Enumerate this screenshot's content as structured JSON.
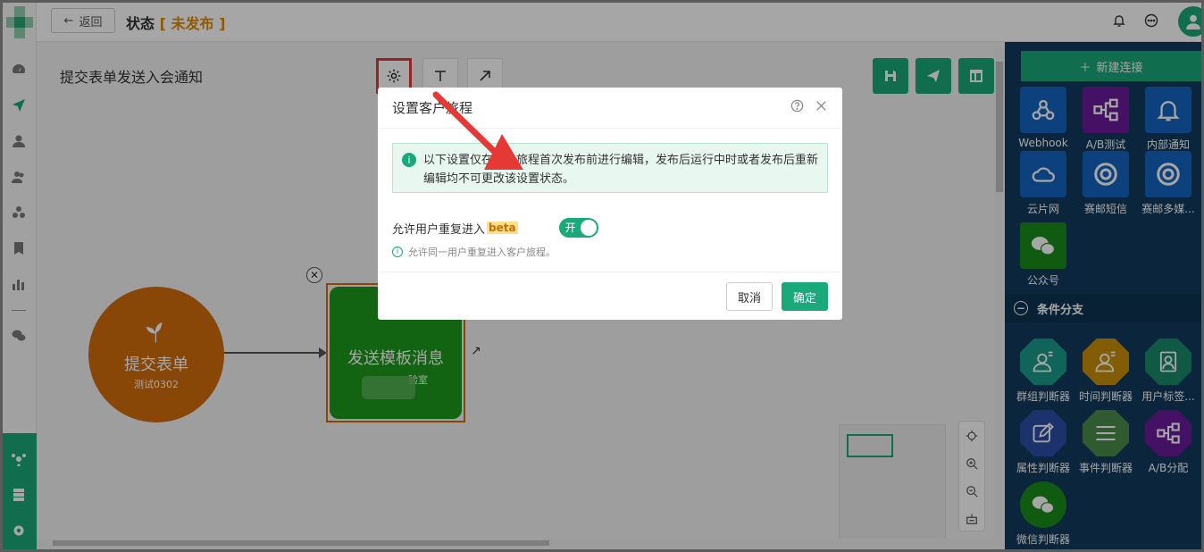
{
  "header": {
    "back_label": "返回",
    "title_prefix": "状态",
    "status_text": "未发布",
    "bracket_open": "[",
    "bracket_close": "]"
  },
  "journey": {
    "name": "提交表单发送入会通知",
    "toolbar": [
      "gear-icon",
      "text-icon",
      "arrow-icon"
    ]
  },
  "nodes": {
    "trigger_title": "提交表单",
    "trigger_sub": "测试0302",
    "action_title": "发送模板消息",
    "action_sub": "验室",
    "close_glyph": "✕"
  },
  "right_panel": {
    "new_connection_label": "新建连接",
    "channels": [
      {
        "label": "Webhook",
        "icon": "webhook-icon",
        "color": "#1565c0"
      },
      {
        "label": "A/B测试",
        "icon": "ab-test-icon",
        "color": "#6a1b9a"
      },
      {
        "label": "内部通知",
        "icon": "bell-icon",
        "color": "#1565c0"
      },
      {
        "label": "云片网",
        "icon": "cloud-icon",
        "color": "#1565c0"
      },
      {
        "label": "赛邮短信",
        "icon": "submail-icon",
        "color": "#1565c0"
      },
      {
        "label": "赛邮多媒...",
        "icon": "submail-media-icon",
        "color": "#1565c0"
      },
      {
        "label": "公众号",
        "icon": "wechat-icon",
        "color": "#1b8a1b"
      }
    ],
    "conditions_header": "条件分支",
    "conditions": [
      {
        "label": "群组判断器",
        "icon": "group-judge-icon",
        "color": "#1a9a8a"
      },
      {
        "label": "时间判断器",
        "icon": "time-judge-icon",
        "color": "#c8900a"
      },
      {
        "label": "用户标签...",
        "icon": "user-tag-icon",
        "color": "#1a8a6a"
      },
      {
        "label": "属性判断器",
        "icon": "attr-judge-icon",
        "color": "#2c4ea8"
      },
      {
        "label": "事件判断器",
        "icon": "event-judge-icon",
        "color": "#4b8a4b"
      },
      {
        "label": "A/B分配",
        "icon": "ab-split-icon",
        "color": "#6a1b9a"
      },
      {
        "label": "微信判断器",
        "icon": "wechat-judge-icon",
        "color": "#1b8a1b"
      }
    ]
  },
  "dialog": {
    "title": "设置客户旅程",
    "info_text": "以下设置仅在客户旅程首次发布前进行编辑，发布后运行中时或者发布后重新编辑均不可更改该设置状态。",
    "option_label": "允许用户重复进入",
    "beta_label": "beta",
    "switch_label": "开",
    "hint_text": "允许同一用户重复进入客户旅程。",
    "cancel_label": "取消",
    "ok_label": "确定",
    "info_glyph": "i"
  },
  "colors": {
    "accent": "#1aa97a",
    "status": "#e08a00",
    "highlight": "#e53935",
    "panel_bg": "#123a5c"
  }
}
